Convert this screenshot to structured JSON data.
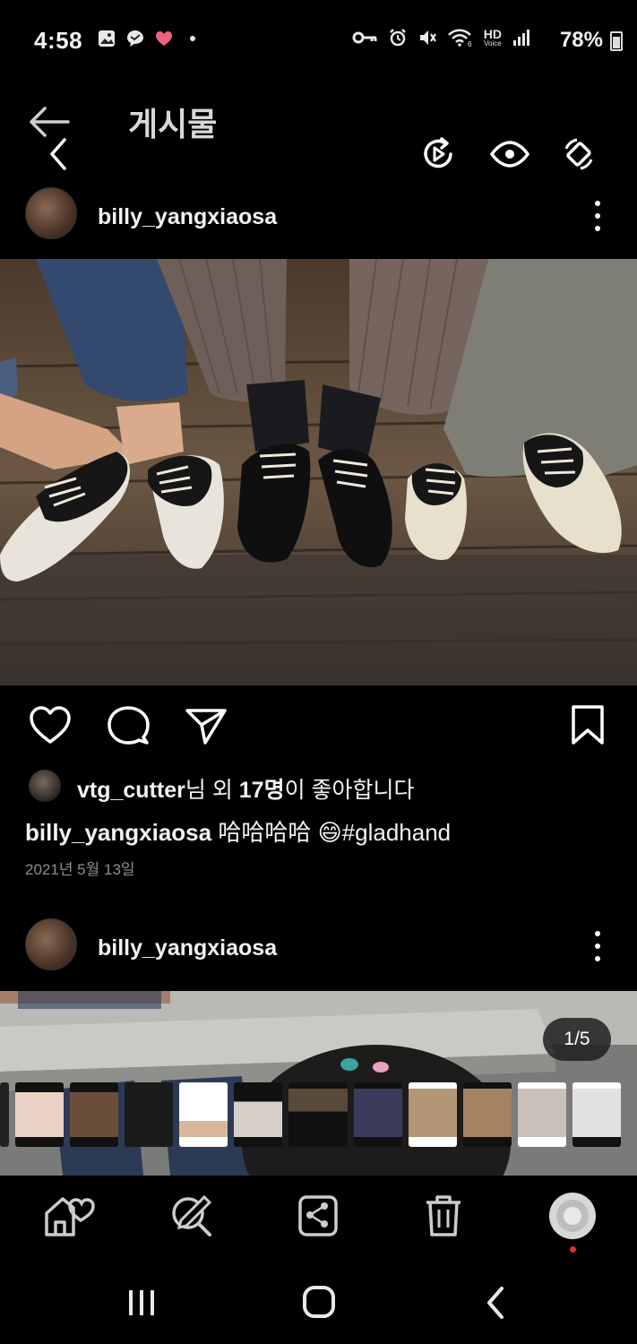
{
  "status_bar": {
    "time": "4:58",
    "battery": "78%",
    "left_icons": [
      "gallery-icon",
      "message-bubble-icon",
      "heart-icon",
      "dot"
    ],
    "right_icons": [
      "key-icon",
      "alarm-icon",
      "mute-icon",
      "wifi-icon",
      "hd-voice-icon",
      "signal-icon"
    ],
    "hd_label": "HD",
    "voice_label": "Voice"
  },
  "header": {
    "title": "게시물"
  },
  "post": {
    "username": "billy_yangxiaosa",
    "likes": {
      "user": "vtg_cutter",
      "mid": "님 외 ",
      "count": "17명",
      "tail": "이 좋아합니다"
    },
    "caption": {
      "user": "billy_yangxiaosa",
      "text": "哈哈哈哈 😄#gladhand"
    },
    "date": "2021년 5월 13일"
  },
  "post2": {
    "username": "billy_yangxiaosa",
    "counter": "1/5"
  },
  "toolbar": {
    "items": [
      "home-heart-icon",
      "search-edit-icon",
      "share-node-icon",
      "delete-icon",
      "profile-icon"
    ]
  },
  "nav": {
    "items": [
      "recents-icon",
      "home-icon",
      "back-icon"
    ]
  },
  "colors": {
    "background": "#000000",
    "text": "#f2f2f2",
    "muted": "#8e8e8e",
    "badge_dot": "#e03030"
  }
}
